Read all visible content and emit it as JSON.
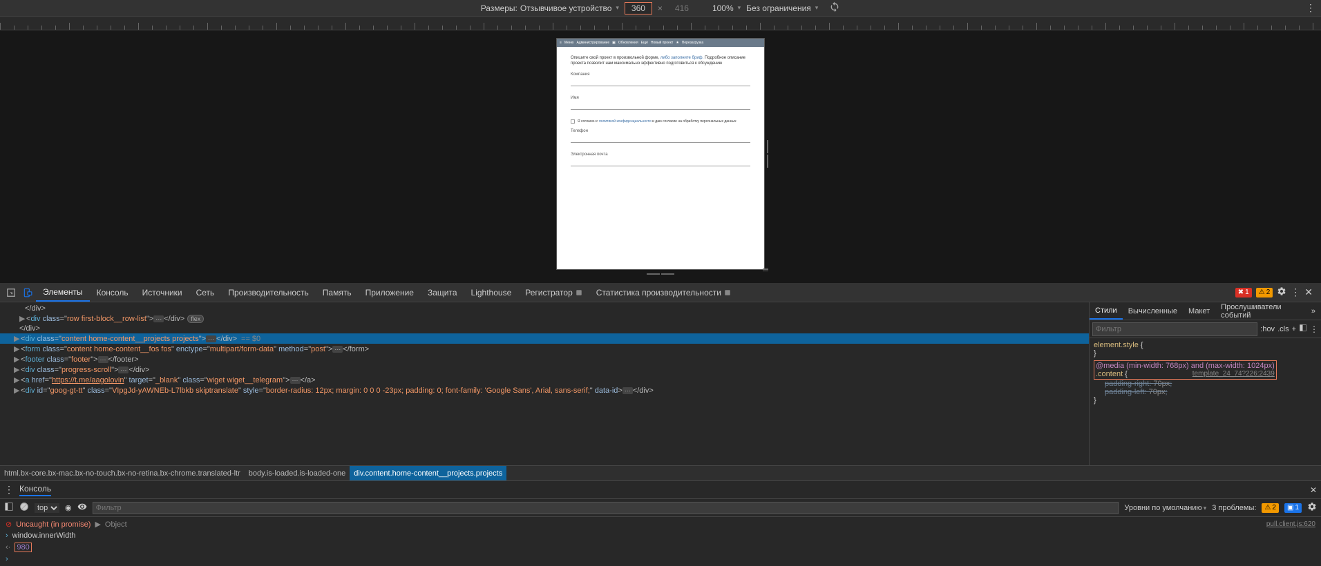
{
  "deviceToolbar": {
    "dimensionsLabel": "Размеры:",
    "deviceName": "Отзывчивое устройство",
    "width": "360",
    "height": "416",
    "zoom": "100%",
    "throttling": "Без ограничения"
  },
  "deviceContent": {
    "navItems": [
      "Меню",
      "Администрирование",
      "",
      "Обновления",
      "Ещё",
      "Новый проект",
      "",
      "Перезагрузка",
      ""
    ],
    "descPrefix": "Опишите свой проект в произвольной форме, ",
    "descLink": "либо заполните бриф.",
    "descSuffix": " Подробное описание проекта позволит нам максимально эффективно подготовиться к обсуждению",
    "fields": {
      "company": "Компания",
      "name": "Имя",
      "phone": "Телефон",
      "email": "Электронная почта"
    },
    "consentPrefix": "Я согласен с ",
    "consentLink": "политикой конфиденциальности",
    "consentSuffix": " и даю согласие на обработку персональных данных"
  },
  "devtoolsTabs": {
    "elements": "Элементы",
    "console": "Консоль",
    "sources": "Источники",
    "network": "Сеть",
    "performance": "Производительность",
    "memory": "Память",
    "application": "Приложение",
    "security": "Защита",
    "lighthouse": "Lighthouse",
    "recorder": "Регистратор",
    "perfStats": "Статистика производительности"
  },
  "errorCount": "1",
  "warnCount": "2",
  "elementsTree": {
    "line1_close": "</div>",
    "line2": {
      "tag": "div",
      "cls": "row first-block__row-list",
      "badge": "flex"
    },
    "line3_close": "</div>",
    "line4": {
      "tag": "div",
      "cls": "content home-content__projects projects",
      "selRef": "== $0"
    },
    "line5": {
      "tag": "form",
      "cls": "content home-content__fos fos",
      "enctype": "multipart/form-data",
      "method": "post"
    },
    "line6": {
      "tag": "footer",
      "cls": "footer"
    },
    "line7": {
      "tag": "div",
      "cls": "progress-scroll"
    },
    "line8": {
      "tag": "a",
      "href": "https://t.me/aagolovin",
      "target": "_blank",
      "cls": "wiget wiget__telegram"
    },
    "line9": {
      "tag": "div",
      "id": "goog-gt-tt",
      "cls": "VIpgJd-yAWNEb-L7lbkb skiptranslate",
      "style": "border-radius: 12px; margin: 0 0 0 -23px; padding: 0; font-family: 'Google Sans', Arial, sans-serif;",
      "dataid": ""
    }
  },
  "breadcrumbs": {
    "html": "html.bx-core.bx-mac.bx-no-touch.bx-no-retina.bx-chrome.translated-ltr",
    "body": "body.is-loaded.is-loaded-one",
    "div": "div.content.home-content__projects.projects"
  },
  "stylesPanel": {
    "tabs": {
      "styles": "Стили",
      "computed": "Вычисленные",
      "layout": "Макет",
      "listeners": "Прослушиватели событий"
    },
    "filterPlaceholder": "Фильтр",
    "hov": ":hov",
    "cls": ".cls",
    "elementStyle": "element.style",
    "mediaQuery": "@media (min-width: 768px) and (max-width: 1024px)",
    "selector": ".content",
    "ruleSource": "template_24_74?226:2439",
    "prop1": {
      "name": "padding-right",
      "value": "70px"
    },
    "prop2": {
      "name": "padding-left",
      "value": "70px"
    }
  },
  "consoleDrawer": {
    "tab": "Консоль",
    "context": "top",
    "filterPlaceholder": "Фильтр",
    "levels": "Уровни по умолчанию",
    "issuesLabel": "3 проблемы:",
    "issueWarn": "2",
    "issueInfo": "1",
    "errLine": "Uncaught (in promise)",
    "errObj": "Object",
    "errSource": "pull.client.js:620",
    "inputLine": "window.innerWidth",
    "resultLine": "980"
  }
}
